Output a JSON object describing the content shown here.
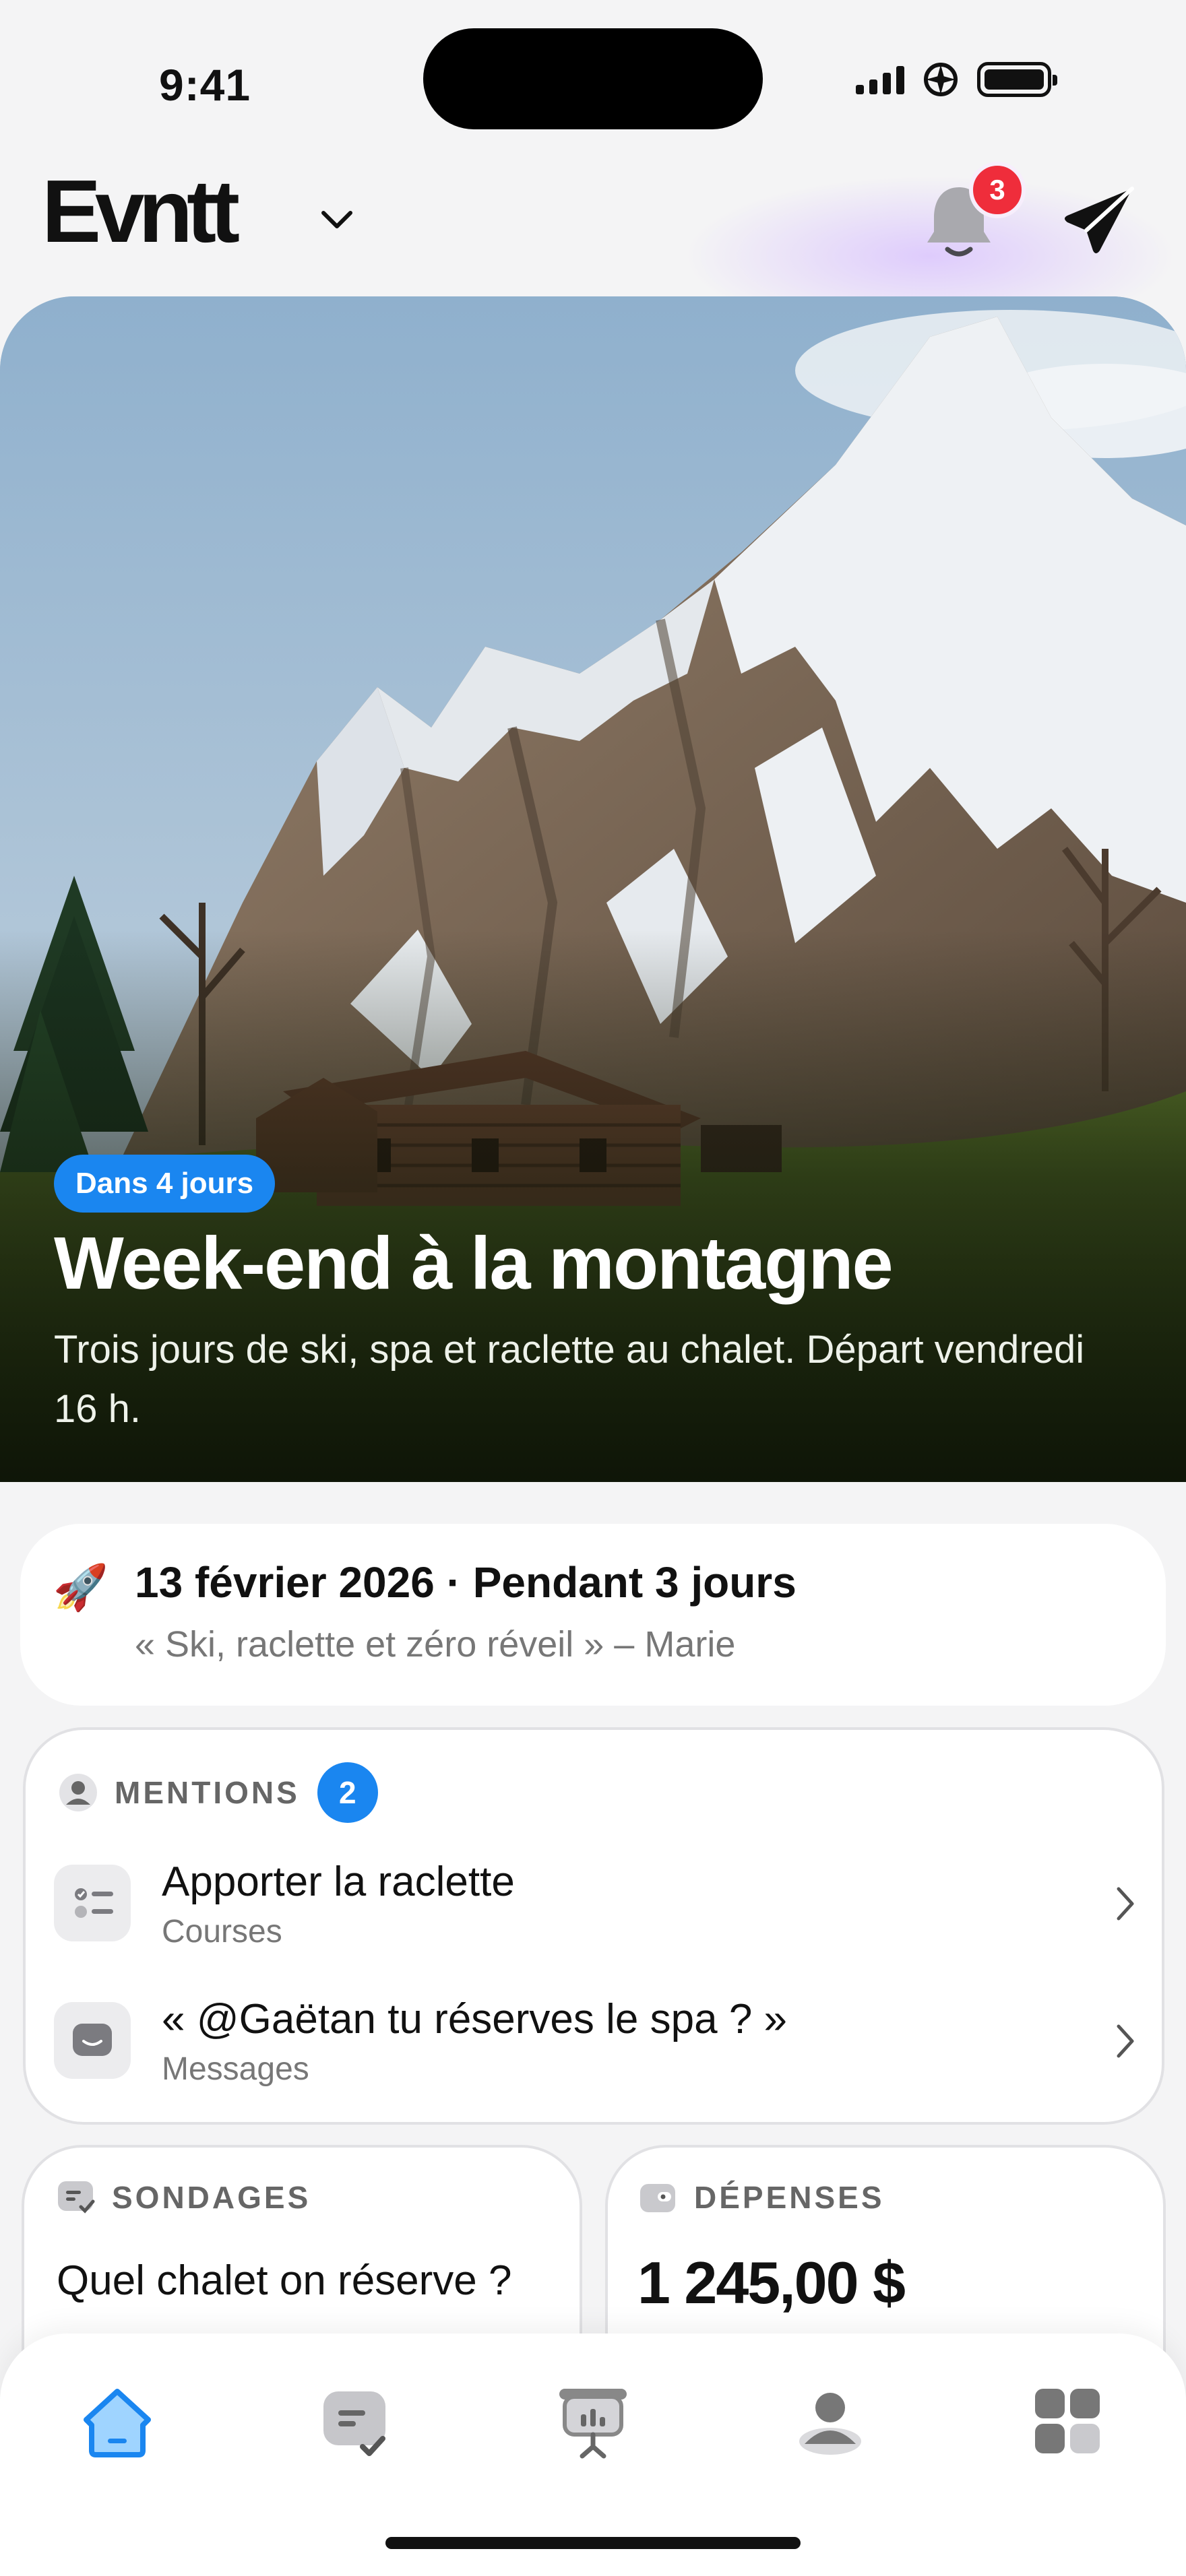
{
  "status_bar": {
    "time": "9:41"
  },
  "header": {
    "logo": "Evntt",
    "notification_count": "3",
    "icons": [
      "chevron-down-icon",
      "bell-icon",
      "send-icon"
    ]
  },
  "hero": {
    "countdown": "Dans 4 jours",
    "title": "Week-end à la montagne",
    "description": "Trois jours de ski, spa et raclette au chalet. Départ vendredi 16 h."
  },
  "event_summary": {
    "icon": "🚀",
    "date_line": "13 février 2026 · Pendant 3 jours",
    "quote": "« Ski, raclette et zéro réveil » – Marie"
  },
  "mentions": {
    "label": "MENTIONS",
    "count": "2",
    "items": [
      {
        "title": "Apporter la raclette",
        "subtitle": "Courses",
        "icon": "checklist-icon"
      },
      {
        "title": "« @Gaëtan tu réserves le spa ? »",
        "subtitle": "Messages",
        "icon": "message-bubble-icon"
      }
    ]
  },
  "polls": {
    "label": "SONDAGES",
    "question": "Quel chalet on réserve ?"
  },
  "expenses": {
    "label": "DÉPENSES",
    "amount": "1 245,00 $"
  },
  "tabbar": {
    "active": "home",
    "tabs": [
      "home-tab",
      "polls-tab",
      "presentation-tab",
      "members-tab",
      "more-tab"
    ]
  },
  "colors": {
    "accent": "#1a86f0",
    "badge_red": "#ef2d3b",
    "background": "#f4f4f5"
  }
}
